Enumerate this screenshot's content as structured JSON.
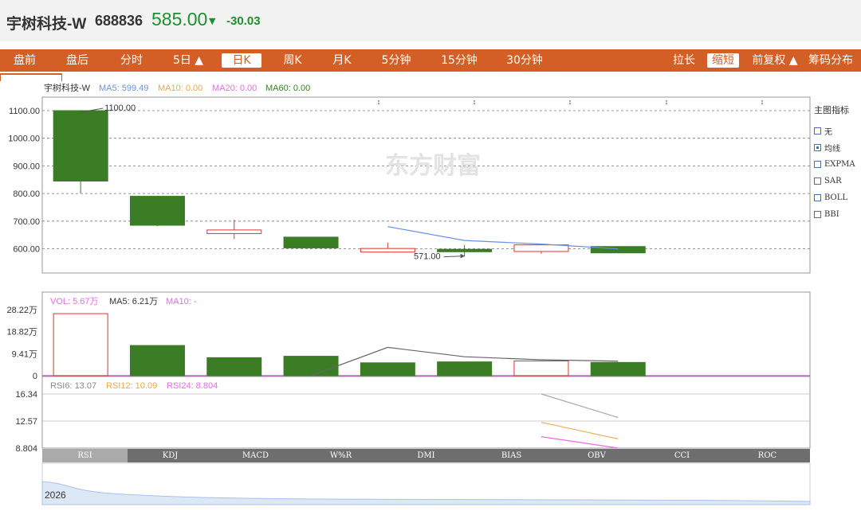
{
  "header": {
    "name": "宇树科技-W",
    "code": "688836",
    "price": "585.00",
    "change": "-30.03"
  },
  "tabs_left": [
    "盘前",
    "盘后",
    "分时",
    "5日 ▲",
    "日K",
    "周K",
    "月K",
    "5分钟",
    "15分钟",
    "30分钟"
  ],
  "tabs_right": [
    "拉长",
    "缩短",
    "前复权 ▲",
    "筹码分布"
  ],
  "active_tab": "日K",
  "main_legend": {
    "name": "宇树科技-W",
    "ma5": "MA5: 599.49",
    "ma10": "MA10: 0.00",
    "ma20": "MA20: 0.00",
    "ma60": "MA60: 0.00"
  },
  "side_panel": {
    "title": "主图指标",
    "items": [
      "无",
      "均线",
      "EXPMA",
      "SAR",
      "BOLL",
      "BBI"
    ],
    "checked": "均线"
  },
  "watermark": "东方财富",
  "colors": {
    "up": "#e0332f",
    "down": "#3a7d24",
    "ma5": "#6c8fe8",
    "vol_ma5": "#666666",
    "rsi6": "#aaaaaa",
    "rsi12": "#e8b35a",
    "rsi24": "#ee66ee",
    "accent": "#d45f26"
  },
  "chart_data": [
    {
      "type": "candlestick",
      "ylim": [
        560,
        1130
      ],
      "yticks": [
        "1100.00",
        "1000.00",
        "900.00",
        "800.00",
        "700.00",
        "600.00"
      ],
      "candles": [
        {
          "open": 1100,
          "close": 845,
          "high": 1100,
          "low": 800
        },
        {
          "open": 790,
          "close": 685,
          "high": 790,
          "low": 682
        },
        {
          "open": 655,
          "close": 668,
          "high": 705,
          "low": 635
        },
        {
          "open": 642,
          "close": 603,
          "high": 642,
          "low": 600
        },
        {
          "open": 588,
          "close": 601,
          "high": 622,
          "low": 586
        },
        {
          "open": 598,
          "close": 589,
          "high": 614,
          "low": 571
        },
        {
          "open": 590,
          "close": 614,
          "high": 614,
          "low": 582
        },
        {
          "open": 608,
          "close": 585,
          "high": 608,
          "low": 584
        }
      ],
      "ma5": [
        null,
        null,
        null,
        null,
        680,
        630,
        617,
        599.49
      ],
      "annotations": {
        "high": "1100.00",
        "low": "571.00"
      }
    },
    {
      "type": "bar",
      "name": "VOL",
      "legend": {
        "vol": "VOL: 5.67万",
        "ma5": "MA5: 6.21万",
        "ma10": "MA10: -"
      },
      "yticks": [
        "28.22万",
        "18.82万",
        "9.41万",
        "0"
      ],
      "ylim": [
        0,
        28.22
      ],
      "values": [
        26.5,
        12.9,
        7.7,
        8.3,
        5.5,
        5.9,
        6.3,
        5.67
      ],
      "direction": [
        "up",
        "down",
        "down",
        "down",
        "down",
        "down",
        "up",
        "down"
      ],
      "ma5": [
        null,
        null,
        null,
        null,
        12.1,
        8.1,
        6.8,
        6.21
      ]
    },
    {
      "type": "line",
      "name": "RSI",
      "legend": {
        "rsi6": "RSI6: 13.07",
        "rsi12": "RSI12: 10.09",
        "rsi24": "RSI24: 8.804"
      },
      "yticks": [
        "16.34",
        "12.57",
        "8.804"
      ],
      "ylim": [
        8.804,
        16.34
      ],
      "series": [
        {
          "name": "RSI6",
          "values": [
            null,
            null,
            null,
            null,
            null,
            null,
            16.34,
            13.07
          ]
        },
        {
          "name": "RSI12",
          "values": [
            null,
            null,
            null,
            null,
            null,
            null,
            12.4,
            10.09
          ]
        },
        {
          "name": "RSI24",
          "values": [
            null,
            null,
            null,
            null,
            null,
            null,
            10.4,
            8.804
          ]
        }
      ]
    }
  ],
  "indicator_tabs": [
    "RSI",
    "KDJ",
    "MACD",
    "W%R",
    "DMI",
    "BIAS",
    "OBV",
    "CCI",
    "ROC"
  ],
  "active_indicator": "RSI",
  "navigator": {
    "year_label": "2026"
  }
}
